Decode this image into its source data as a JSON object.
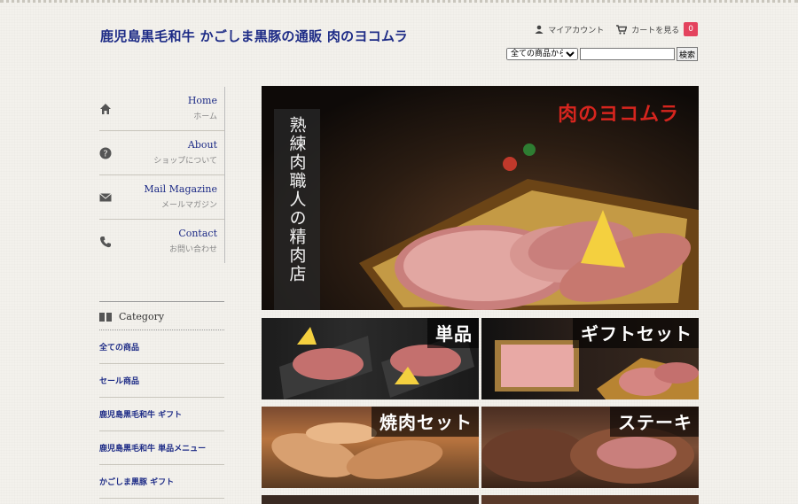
{
  "site": {
    "title": "鹿児島黒毛和牛 かごしま黒豚の通販 肉のヨコムラ"
  },
  "header": {
    "account_label": "マイアカウント",
    "cart_label": "カートを見る",
    "cart_count": "0"
  },
  "search": {
    "select_value": "全ての商品から",
    "button_label": "検索"
  },
  "nav": {
    "items": [
      {
        "en": "Home",
        "ja": "ホーム",
        "icon": "home-icon"
      },
      {
        "en": "About",
        "ja": "ショップについて",
        "icon": "question-icon"
      },
      {
        "en": "Mail Magazine",
        "ja": "メールマガジン",
        "icon": "mail-icon"
      },
      {
        "en": "Contact",
        "ja": "お問い合わせ",
        "icon": "phone-icon"
      }
    ]
  },
  "category": {
    "heading": "Category",
    "items": [
      "全ての商品",
      "セール商品",
      "鹿児島黒毛和牛 ギフト",
      "鹿児島黒毛和牛 単品メニュー",
      "かごしま黒豚 ギフト"
    ]
  },
  "hero": {
    "vertical_text": "熟練肉職人の精肉店",
    "logo_text": "肉のヨコムラ"
  },
  "tiles": [
    {
      "label": "単品"
    },
    {
      "label": "ギフトセット"
    },
    {
      "label": "焼肉セット"
    },
    {
      "label": "ステーキ"
    }
  ],
  "colors": {
    "title": "#1d2b86",
    "badge": "#e4435e",
    "logo": "#d6251e"
  }
}
